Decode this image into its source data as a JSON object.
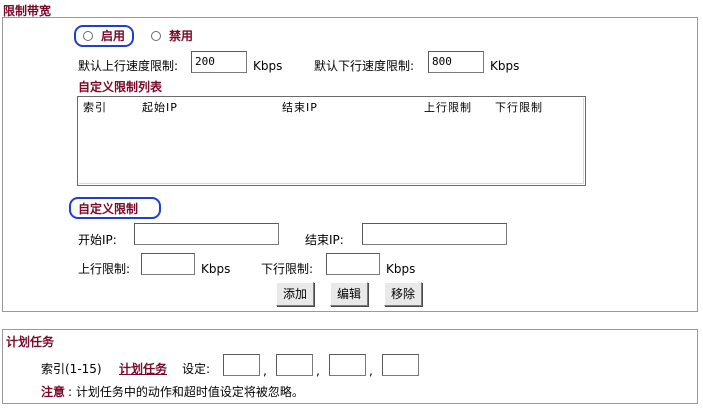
{
  "bandwidth": {
    "title": "限制带宽",
    "enable_label": "启用",
    "disable_label": "禁用",
    "default_up_label": "默认上行速度限制:",
    "default_up_value": "200",
    "default_up_unit": "Kbps",
    "default_down_label": "默认下行速度限制:",
    "default_down_value": "800",
    "default_down_unit": "Kbps",
    "custom_list_title": "自定义限制列表",
    "columns": [
      "索引",
      "起始IP",
      "结束IP",
      "上行限制",
      "下行限制"
    ],
    "custom_title": "自定义限制",
    "start_ip_label": "开始IP:",
    "start_ip_value": "",
    "end_ip_label": "结束IP:",
    "end_ip_value": "",
    "up_label": "上行限制:",
    "up_value": "",
    "up_unit": "Kbps",
    "down_label": "下行限制:",
    "down_value": "",
    "down_unit": "Kbps",
    "buttons": {
      "add": "添加",
      "edit": "编辑",
      "remove": "移除"
    }
  },
  "schedule": {
    "title": "计划任务",
    "index_label": "索引(1-15)",
    "link_label": "计划任务",
    "set_label": "设定:",
    "fields": [
      "",
      "",
      "",
      ""
    ],
    "separator": ",",
    "note_label": "注意",
    "note_text": ": 计划任务中的动作和超时值设定将被忽略。"
  },
  "colors": {
    "accent": "#7a0a2a",
    "highlight_oval": "#1d3fd6"
  }
}
